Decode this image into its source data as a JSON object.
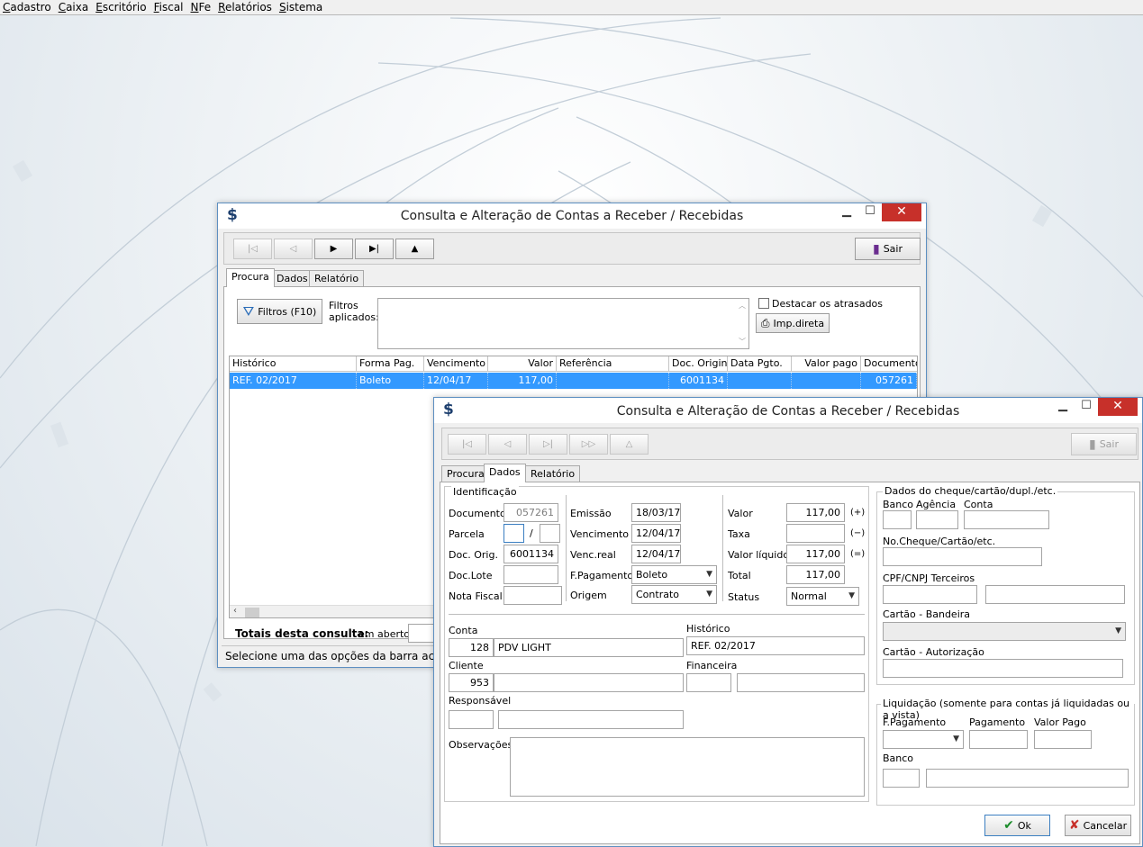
{
  "menu": {
    "items": [
      "Cadastro",
      "Caixa",
      "Escritório",
      "Fiscal",
      "NFe",
      "Relatórios",
      "Sistema"
    ]
  },
  "colors": {
    "selection": "#3399ff",
    "close_button": "#c7302a",
    "window_border": "#5d8fc1"
  },
  "back_window": {
    "title": "Consulta e Alteração de Contas a Receber / Recebidas",
    "icon": "dollar-icon",
    "toolbar": {
      "first": "first-record-icon",
      "prev": "prev-record-icon",
      "next": "▶",
      "last": "▶|",
      "up": "▲",
      "exit_label": "Sair"
    },
    "tabs": [
      "Procura",
      "Dados",
      "Relatório"
    ],
    "filters_button": "Filtros (F10)",
    "filters_label": "Filtros aplicados:",
    "highlight_overdue": "Destacar os atrasados",
    "print_button": "Imp.direta",
    "grid": {
      "columns": [
        "Histórico",
        "Forma Pag.",
        "Vencimento",
        "Valor",
        "Referência",
        "Doc. Original",
        "Data Pgto.",
        "Valor pago",
        "Documento"
      ],
      "rows": [
        [
          "REF. 02/2017",
          "Boleto",
          "12/04/17",
          "117,00",
          "",
          "6001134",
          "",
          "",
          "057261"
        ]
      ]
    },
    "totals_label": "Totais desta consulta:",
    "open_label": "em aberto:",
    "status_text": "Selecione uma das opções da barra acima"
  },
  "front_window": {
    "title": "Consulta e Alteração de Contas a Receber / Recebidas",
    "icon": "dollar-icon",
    "toolbar": {
      "exit_label": "Sair"
    },
    "tabs": [
      "Procura",
      "Dados",
      "Relatório"
    ],
    "identificacao": {
      "title": "Identificação",
      "documento_label": "Documento",
      "documento": "057261",
      "parcela_label": "Parcela",
      "parcela": "",
      "parcela_sep": "/",
      "parcela_total": "",
      "doc_orig_label": "Doc. Orig.",
      "doc_orig": "6001134",
      "doc_lote_label": "Doc.Lote",
      "doc_lote": "",
      "nota_fiscal_label": "Nota Fiscal",
      "nota_fiscal": ""
    },
    "datas": {
      "emissao_label": "Emissão",
      "emissao": "18/03/17",
      "vencimento_label": "Vencimento",
      "vencimento": "12/04/17",
      "venc_real_label": "Venc.real",
      "venc_real": "12/04/17",
      "fpagamento_label": "F.Pagamento",
      "fpagamento": "Boleto",
      "origem_label": "Origem",
      "origem": "Contrato"
    },
    "valores": {
      "valor_label": "Valor",
      "valor": "117,00",
      "valor_sign": "(+)",
      "taxa_label": "Taxa",
      "taxa": "",
      "taxa_sign": "(−)",
      "liquido_label": "Valor líquido",
      "liquido": "117,00",
      "liquido_sign": "(=)",
      "total_label": "Total",
      "total": "117,00",
      "status_label": "Status",
      "status": "Normal"
    },
    "conta": {
      "label": "Conta",
      "codigo": "128",
      "nome": "PDV LIGHT"
    },
    "historico": {
      "label": "Histórico",
      "valor": "REF. 02/2017"
    },
    "cliente": {
      "label": "Cliente",
      "codigo": "953",
      "nome": ""
    },
    "financeira": {
      "label": "Financeira"
    },
    "responsavel": {
      "label": "Responsável"
    },
    "observacoes": {
      "label": "Observações"
    },
    "cheque": {
      "title": "Dados do cheque/cartão/dupl./etc.",
      "banco": "Banco",
      "agencia": "Agência",
      "conta": "Conta",
      "numero": "No.Cheque/Cartão/etc.",
      "cpf": "CPF/CNPJ Terceiros",
      "bandeira": "Cartão - Bandeira",
      "autorizacao": "Cartão - Autorização"
    },
    "liquidacao": {
      "title": "Liquidação (somente para contas já liquidadas ou a vista)",
      "fpagamento": "F.Pagamento",
      "pagamento": "Pagamento",
      "valor_pago": "Valor Pago",
      "banco": "Banco"
    },
    "ok_label": "Ok",
    "cancel_label": "Cancelar"
  }
}
